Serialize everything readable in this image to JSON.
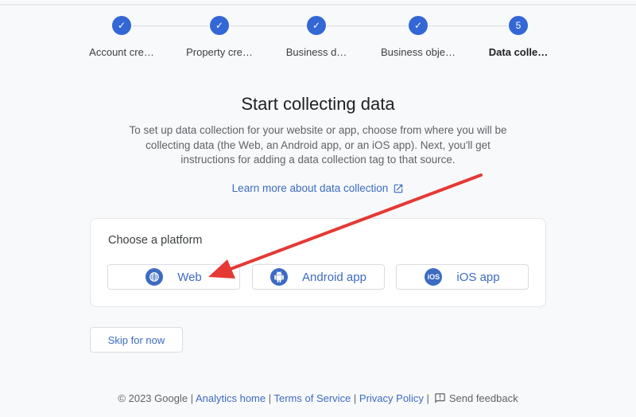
{
  "stepper": {
    "steps": [
      {
        "label": "Account cre…",
        "status": "complete",
        "marker": "✓"
      },
      {
        "label": "Property cre…",
        "status": "complete",
        "marker": "✓"
      },
      {
        "label": "Business d…",
        "status": "complete",
        "marker": "✓"
      },
      {
        "label": "Business obje…",
        "status": "complete",
        "marker": "✓"
      },
      {
        "label": "Data colle…",
        "status": "active",
        "marker": "5"
      }
    ]
  },
  "main": {
    "title": "Start collecting data",
    "description": "To set up data collection for your website or app, choose from where you will be collecting data (the Web, an Android app, or an iOS app). Next, you'll get instructions for adding a data collection tag to that source.",
    "learn_more_link": "Learn more about data collection"
  },
  "platform_card": {
    "title": "Choose a platform",
    "options": [
      {
        "label": "Web",
        "icon": "globe-icon"
      },
      {
        "label": "Android app",
        "icon": "android-icon"
      },
      {
        "label": "iOS app",
        "icon": "ios-icon",
        "icon_text": "iOS"
      }
    ]
  },
  "skip_button": "Skip for now",
  "footer": {
    "copyright": "© 2023 Google",
    "separator": " | ",
    "links": [
      "Analytics home",
      "Terms of Service",
      "Privacy Policy"
    ],
    "feedback": "Send feedback"
  },
  "annotation": {
    "type": "arrow",
    "color": "#e53935",
    "points_to": "Web"
  },
  "colors": {
    "accent": "#3367d6",
    "link": "#3c6bc2",
    "background": "#f8f9fa"
  }
}
